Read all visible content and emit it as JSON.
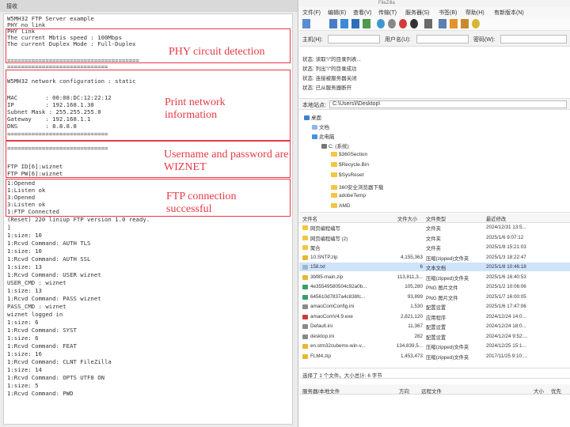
{
  "terminal": {
    "title": "接收",
    "lines": [
      "W5MH32 FTP Server example",
      "PHY no link",
      "PHY link",
      "The current Mbtis speed : 100Mbps",
      "The current Duplex Mode : Full-Duplex",
      "======================================",
      "=============================",
      "W5MH32 network configuration : static",
      "",
      "MAC        : 00:08:DC:12:22:12",
      "IP         : 192.168.1.30",
      "Subnet Mask : 255.255.255.0",
      "Gateway    : 192.168.1.1",
      "DNS        : 8.8.8.8",
      "=============================",
      "",
      "=============================",
      "",
      "FTP ID[6]:wiznet",
      "FTP PW[6]:wiznet",
      "1:Opened",
      "1:Listen ok",
      "3:Opened",
      "3:Listen ok",
      "1:FTP Connected",
      "(Reset) 220 liniup FTP version 1.0 ready.",
      "]",
      "1:size: 10",
      "1:Rcvd Command: AUTH TLS",
      "1:size: 10",
      "1:Rcvd Command: AUTH SSL",
      "1:size: 13",
      "1:Rcvd Command: USER wiznet",
      "USER_CMD : wiznet",
      "1:size: 13",
      "1:Rcvd Command: PASS wiznet",
      "PASS_CMD : wiznet",
      "wiznet logged in",
      "1:size: 6",
      "1:Rcvd Command: SYST",
      "1:size: 6",
      "1:Rcvd Command: FEAT",
      "1:size: 16",
      "1:Rcvd Command: CLNT FileZilla",
      "1:size: 14",
      "1:Rcvd Command: OPTS UTF8 ON",
      "1:size: 5",
      "1:Rcvd Command: PWD"
    ],
    "annotations": [
      "PHY circuit detection",
      "Print network information",
      "Username and password are WIZNET",
      "FTP connection successful"
    ]
  },
  "filezilla": {
    "title": "FileZilla",
    "menu": [
      "文件(F)",
      "编辑(E)",
      "查看(V)",
      "传输(T)",
      "服务器(S)",
      "书签(B)",
      "帮助(H)",
      "有新版本(N)"
    ],
    "quickconnect": {
      "host_label": "主机(H):",
      "user_label": "用户名(U):",
      "pass_label": "密码(W):"
    },
    "messages": [
      {
        "label": "状态:",
        "text": "读取\"/\"的目录列表..."
      },
      {
        "label": "状态:",
        "text": "列出\"/\"的目录成功"
      },
      {
        "label": "状态:",
        "text": "连接被服务器关闭"
      },
      {
        "label": "状态:",
        "text": "已从服务器断开"
      }
    ],
    "local_site_label": "本地站点:",
    "local_site_path": "C:\\Users\\l\\Desktop\\",
    "tree": [
      {
        "label": "桌面",
        "level": 0,
        "icon": "desktop"
      },
      {
        "label": "文档",
        "level": 1,
        "icon": "doc"
      },
      {
        "label": "此电脑",
        "level": 1,
        "icon": "pc"
      },
      {
        "label": "C: (系统)",
        "level": 2,
        "icon": "drive"
      },
      {
        "label": "$360Section",
        "level": 3,
        "icon": "folder"
      },
      {
        "label": "$Recycle.Bin",
        "level": 3,
        "icon": "folder"
      },
      {
        "label": "$SysReset",
        "level": 3,
        "icon": "folder"
      },
      {
        "label": "360安全浏览器下载",
        "level": 3,
        "icon": "folder"
      },
      {
        "label": "adobeTemp",
        "level": 3,
        "icon": "folder"
      },
      {
        "label": "AMD",
        "level": 3,
        "icon": "folder"
      }
    ],
    "file_headers": [
      "文件名",
      "文件大小",
      "文件类型",
      "最近修改"
    ],
    "files": [
      {
        "name": "网页编程编写",
        "size": "",
        "type": "文件夹",
        "modified": "2024/12/31 13:5..."
      },
      {
        "name": "网页编程编写 (2)",
        "size": "",
        "type": "文件夹",
        "modified": "2025/1/6 9:07:12"
      },
      {
        "name": "聚合",
        "size": "",
        "type": "文件夹",
        "modified": "2025/1/8 15:21:03"
      },
      {
        "name": "10.SNTP.zip",
        "size": "4,155,363",
        "type": "压缩(zipped)文件夹",
        "modified": "2025/1/3 18:22:47"
      },
      {
        "name": "158.txt",
        "size": "6",
        "type": "文本文档",
        "modified": "2025/1/8 10:46:18"
      },
      {
        "name": "3bf85-main.zip",
        "size": "113,811,3...",
        "type": "压缩(zipped)文件夹",
        "modified": "2025/1/6 16:40:53"
      },
      {
        "name": "4e35549580504c92a0b...",
        "size": "105,280",
        "type": "PNG 图片文件",
        "modified": "2025/1/2 10:06:06"
      },
      {
        "name": "645610d7837a4c838fc...",
        "size": "93,899",
        "type": "PNG 图片文件",
        "modified": "2025/1/7 16:00:05"
      },
      {
        "name": "amaoComConfig.ini",
        "size": "1,530",
        "type": "配置设置",
        "modified": "2025/1/6 17:47:06"
      },
      {
        "name": "amaoComV4.9.exe",
        "size": "2,821,120",
        "type": "应用程序",
        "modified": "2024/12/24 14:0..."
      },
      {
        "name": "Default.ini",
        "size": "11,367",
        "type": "配置设置",
        "modified": "2024/12/24 18:0..."
      },
      {
        "name": "desktop.ini",
        "size": "282",
        "type": "配置设置",
        "modified": "2024/12/24 9:52:..."
      },
      {
        "name": "en.stm32cubemx-win-v...",
        "size": "134,839,5...",
        "type": "压缩(zipped)文件夹",
        "modified": "2024/12/25 15:1..."
      },
      {
        "name": "FLM4.zip",
        "size": "1,453,473",
        "type": "压缩(zipped)文件夹",
        "modified": "2017/11/25 9:10:..."
      }
    ],
    "status_text": "选择了 1 个文件。大小总计: 6 字节",
    "queue_headers": [
      "服务器/本地文件",
      "方向",
      "远程文件",
      "大小",
      "优先"
    ],
    "colors": {
      "accent": "#3875d7",
      "folder": "#f4c542"
    }
  }
}
